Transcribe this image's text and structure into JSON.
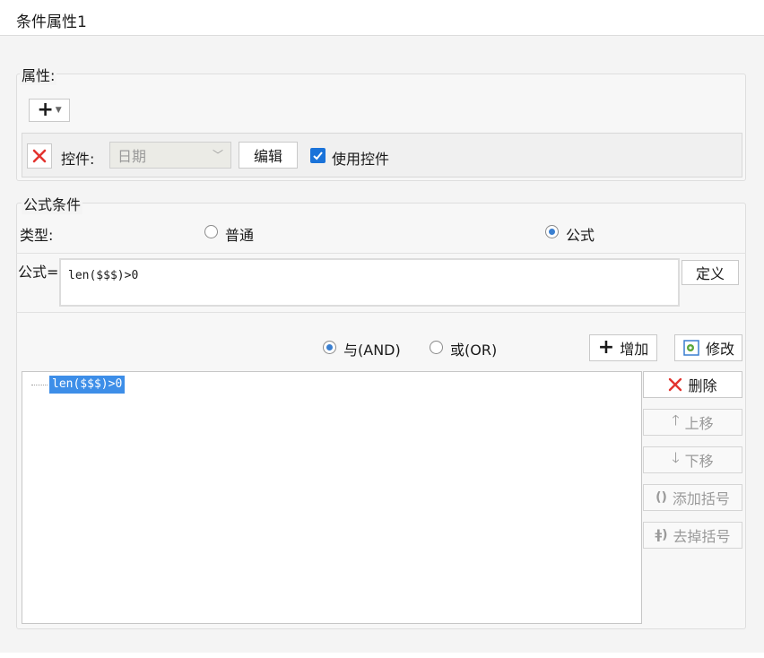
{
  "window": {
    "title": "条件属性1"
  },
  "properties": {
    "legend": "属性:",
    "add_button_symbol": "+",
    "control_label": "控件:",
    "control_value": "日期",
    "edit_button": "编辑",
    "use_control_label": "使用控件",
    "use_control_checked": true
  },
  "formula_condition": {
    "legend": "公式条件",
    "type_label": "类型:",
    "type_options": [
      "普通",
      "公式"
    ],
    "type_selected": "公式",
    "formula_label": "公式=",
    "formula_value": "len($$$)>0",
    "define_button": "定义"
  },
  "logic": {
    "and_label": "与(AND)",
    "or_label": "或(OR)",
    "selected": "与(AND)",
    "add_button": "增加",
    "modify_button": "修改"
  },
  "condition_list": {
    "items": [
      "len($$$)>0"
    ],
    "selected_index": 0
  },
  "side_buttons": {
    "delete": "删除",
    "move_up": "上移",
    "move_down": "下移",
    "add_bracket": "添加括号",
    "remove_bracket": "去掉括号"
  },
  "colors": {
    "accent": "#3d8ee8",
    "delete_red": "#e3342f",
    "checkbox_blue": "#1a73d9"
  }
}
